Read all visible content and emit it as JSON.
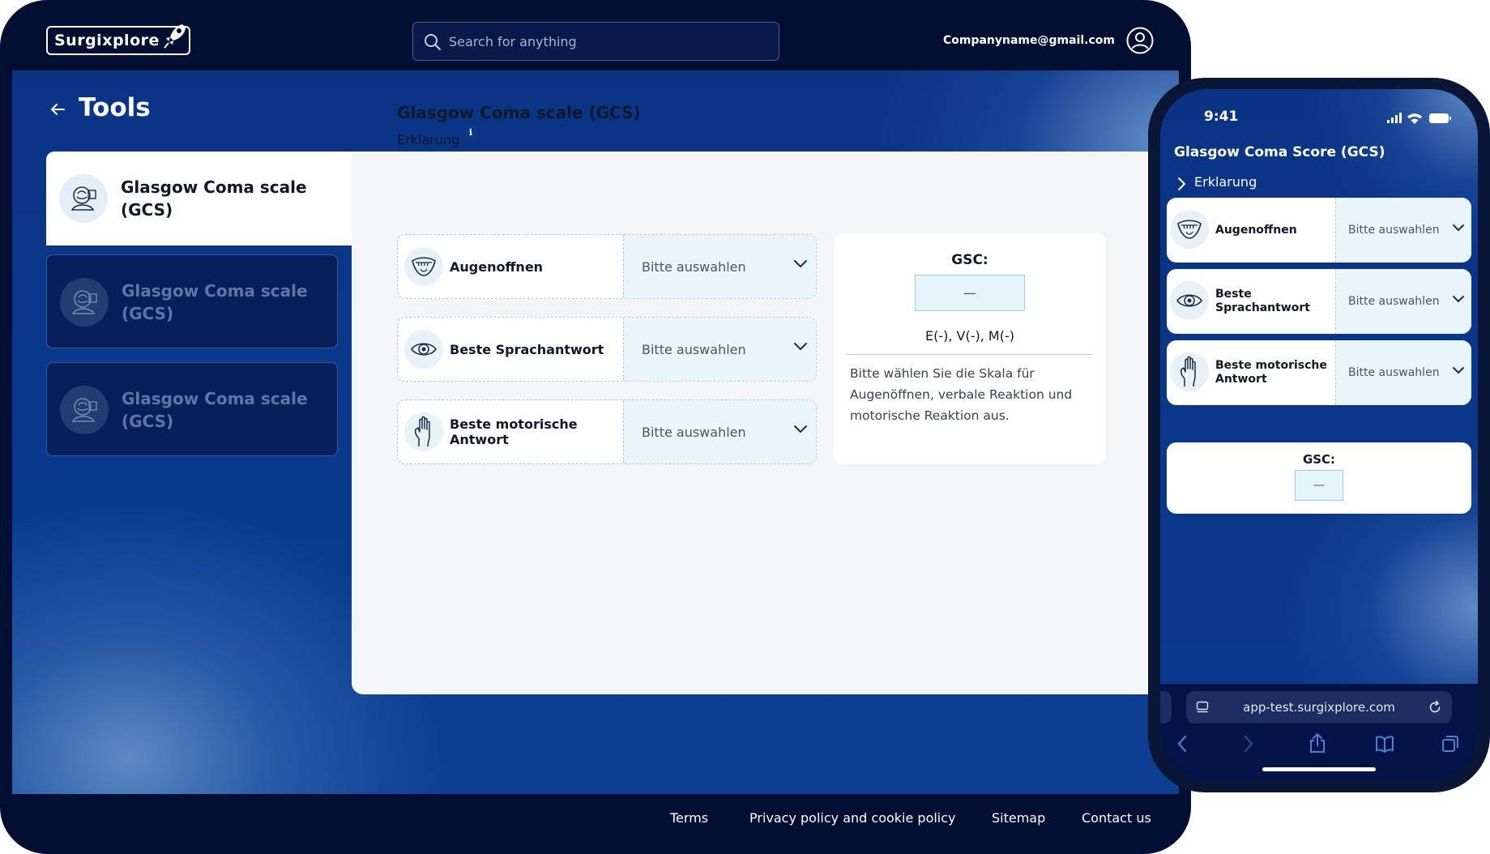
{
  "app": {
    "logo_text": "Surgixplore",
    "search_placeholder": "Search for anything",
    "user_email": "Companyname@gmail.com"
  },
  "page": {
    "title": "Tools"
  },
  "tools": [
    {
      "label": "Glasgow Coma scale (GCS)",
      "active": true
    },
    {
      "label": "Glasgow Coma scale (GCS)",
      "active": false
    },
    {
      "label": "Glasgow Coma scale (GCS)",
      "active": false
    }
  ],
  "calculator": {
    "title": "Glasgow Coma scale (GCS)",
    "explanation_label": "Erklarung",
    "info_glyph": "i",
    "rows": [
      {
        "label": "Augenoffnen",
        "icon": "mouth-icon",
        "select": "Bitte auswahlen"
      },
      {
        "label": "Beste Sprachantwort",
        "icon": "eye-icon",
        "select": "Bitte auswahlen"
      },
      {
        "label": "Beste motorische Antwort",
        "icon": "hand-icon",
        "select": "Bitte auswahlen"
      }
    ],
    "result": {
      "heading": "GSC:",
      "value": "—",
      "breakdown": "E(-), V(-), M(-)",
      "description": "Bitte wählen Sie die Skala für Augenöffnen, verbale Reaktion und motorische Reaktion aus."
    }
  },
  "footer": {
    "links": [
      "Terms",
      "Privacy policy and cookie policy",
      "Sitemap",
      "Contact us"
    ]
  },
  "phone": {
    "time": "9:41",
    "title": "Glasgow Coma Score (GCS)",
    "explanation_label": "Erklarung",
    "rows": [
      {
        "label": "Augenoffnen",
        "icon": "mouth-icon",
        "select": "Bitte auswahlen"
      },
      {
        "label": "Beste Sprachantwort",
        "icon": "eye-icon",
        "select": "Bitte auswahlen"
      },
      {
        "label": "Beste motorische Antwort",
        "icon": "hand-icon",
        "select": "Bitte auswahlen"
      }
    ],
    "result": {
      "heading": "GSC:",
      "value": "—"
    },
    "url": "app-test.surgixplore.com"
  },
  "colors": {
    "navy": "#020f33",
    "brand_blue": "#0a3384",
    "panel": "#f3f5f7",
    "select_bg": "#e9f5fb"
  }
}
